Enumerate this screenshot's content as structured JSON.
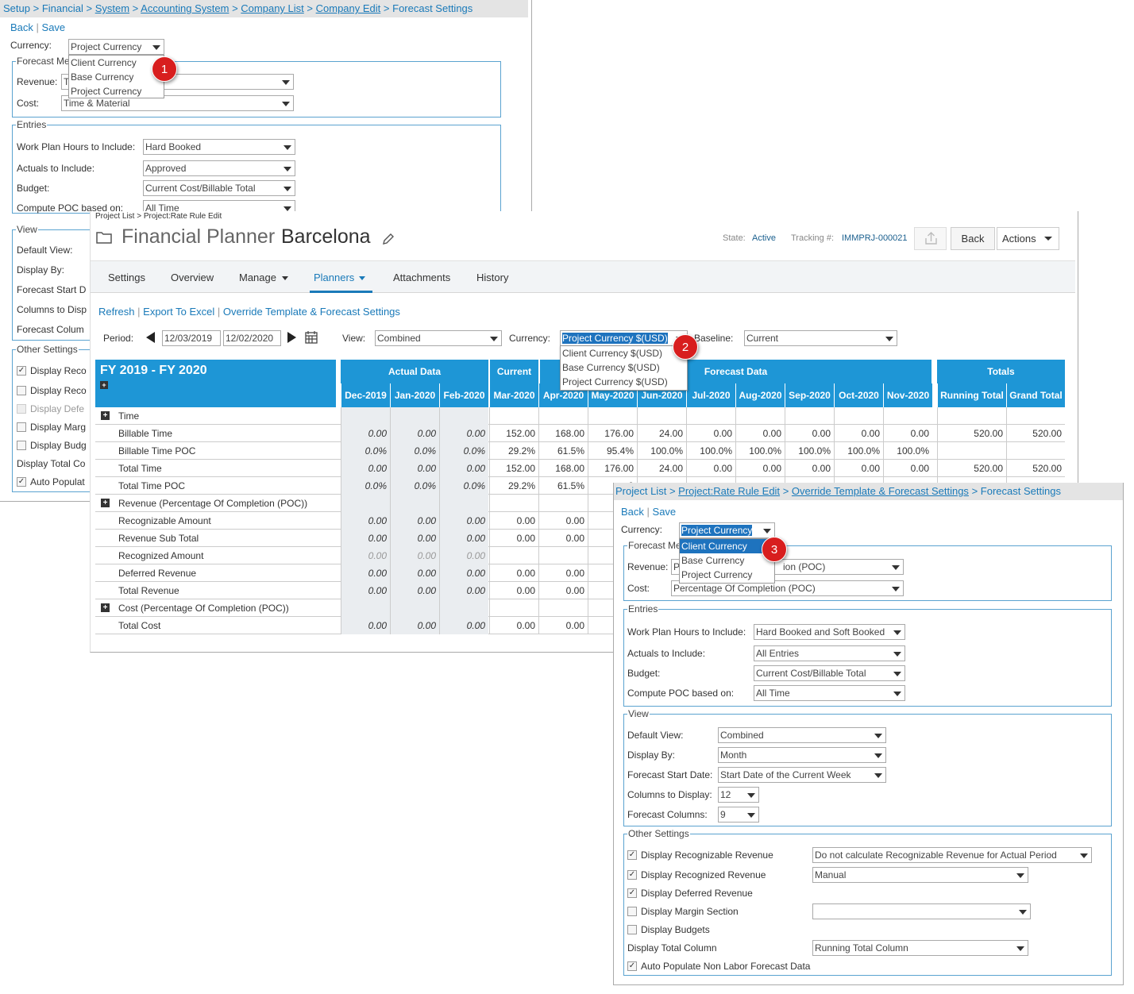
{
  "back_panel": {
    "breadcrumb": [
      "Setup",
      "Financial",
      "System",
      "Accounting System",
      "Company List",
      "Company Edit"
    ],
    "breadcrumb_current": "Forecast Settings",
    "sep": ">",
    "back": "Back",
    "save": "Save",
    "currency_label": "Currency:",
    "currency_value": "Project Currency",
    "currency_options": [
      "Client Currency",
      "Base Currency",
      "Project Currency"
    ],
    "forecast_method_legend": "Forecast Me",
    "revenue_label": "Revenue:",
    "revenue_value": "T",
    "cost_label": "Cost:",
    "cost_value": "Time & Material",
    "entries_legend": "Entries",
    "wph_label": "Work Plan Hours to Include:",
    "wph_value": "Hard Booked",
    "actuals_label": "Actuals to Include:",
    "actuals_value": "Approved",
    "budget_label": "Budget:",
    "budget_value": "Current Cost/Billable Total",
    "poc_label": "Compute POC based on:",
    "poc_value": "All Time",
    "view_legend": "View",
    "default_view_label": "Default View:",
    "display_by_label": "Display By:",
    "forecast_start_label": "Forecast Start D",
    "columns_label": "Columns to Disp",
    "forecast_columns_label": "Forecast Colum",
    "other_legend": "Other Settings",
    "other_items": [
      "Display Reco",
      "Display Reco",
      "Display Defe",
      "Display Marg",
      "Display Budg",
      "Display Total Co",
      "Auto Populat"
    ]
  },
  "planner": {
    "breadcrumb": "Project List > Project:Rate Rule Edit",
    "title": "Financial Planner",
    "project": "Barcelona",
    "state_label": "State:",
    "state_value": "Active",
    "tracking_label": "Tracking #:",
    "tracking_value": "IMMPRJ-000021",
    "back": "Back",
    "actions": "Actions",
    "tabs": [
      "Settings",
      "Overview",
      "Manage",
      "Planners",
      "Attachments",
      "History"
    ],
    "links": [
      "Refresh",
      "Export To Excel",
      "Override Template & Forecast Settings"
    ],
    "period_label": "Period:",
    "period_start": "12/03/2019",
    "period_end": "12/02/2020",
    "view_label": "View:",
    "view_value": "Combined",
    "currency_label": "Currency:",
    "currency_value": "Project Currency $(USD)",
    "currency_options": [
      "Client Currency $(USD)",
      "Base Currency $(USD)",
      "Project Currency $(USD)"
    ],
    "baseline_label": "Baseline:",
    "baseline_value": "Current",
    "fy": "FY 2019 - FY 2020",
    "groups": {
      "actual": "Actual Data",
      "current": "Current",
      "forecast": "Forecast Data",
      "totals": "Totals"
    },
    "months": [
      "Dec-2019",
      "Jan-2020",
      "Feb-2020",
      "Mar-2020",
      "Apr-2020",
      "May-2020",
      "Jun-2020",
      "Jul-2020",
      "Aug-2020",
      "Sep-2020",
      "Oct-2020",
      "Nov-2020"
    ],
    "totals_cols": [
      "Running Total",
      "Grand Total"
    ],
    "rows": [
      {
        "name": "Time",
        "group": true,
        "vals": [
          "",
          "",
          "",
          "",
          "",
          "",
          "",
          "",
          "",
          "",
          "",
          ""
        ],
        "tot": [
          "",
          ""
        ]
      },
      {
        "name": "Billable Time",
        "vals": [
          "0.00",
          "0.00",
          "0.00",
          "152.00",
          "168.00",
          "176.00",
          "24.00",
          "0.00",
          "0.00",
          "0.00",
          "0.00",
          "0.00"
        ],
        "tot": [
          "520.00",
          "520.00"
        ]
      },
      {
        "name": "Billable Time POC",
        "vals": [
          "0.0%",
          "0.0%",
          "0.0%",
          "29.2%",
          "61.5%",
          "95.4%",
          "100.0%",
          "100.0%",
          "100.0%",
          "100.0%",
          "100.0%",
          "100.0%"
        ],
        "tot": [
          "",
          ""
        ]
      },
      {
        "name": "Total Time",
        "vals": [
          "0.00",
          "0.00",
          "0.00",
          "152.00",
          "168.00",
          "176.00",
          "24.00",
          "0.00",
          "0.00",
          "0.00",
          "0.00",
          "0.00"
        ],
        "tot": [
          "520.00",
          "520.00"
        ]
      },
      {
        "name": "Total Time POC",
        "vals": [
          "0.0%",
          "0.0%",
          "0.0%",
          "29.2%",
          "61.5%",
          "9",
          "",
          "",
          "",
          "",
          "",
          ""
        ],
        "tot": [
          "",
          ""
        ]
      },
      {
        "name": "Revenue (Percentage Of Completion (POC))",
        "group": true,
        "vals": [
          "",
          "",
          "",
          "",
          "",
          "",
          "",
          "",
          "",
          "",
          "",
          ""
        ],
        "tot": [
          "",
          ""
        ]
      },
      {
        "name": "Recognizable Amount",
        "vals": [
          "0.00",
          "0.00",
          "0.00",
          "0.00",
          "0.00",
          "",
          "",
          "",
          "",
          "",
          "",
          ""
        ],
        "tot": [
          "",
          ""
        ]
      },
      {
        "name": "Revenue Sub Total",
        "vals": [
          "0.00",
          "0.00",
          "0.00",
          "0.00",
          "0.00",
          "",
          "",
          "",
          "",
          "",
          "",
          ""
        ],
        "tot": [
          "",
          ""
        ]
      },
      {
        "name": "Recognized Amount",
        "dim": true,
        "vals": [
          "0.00",
          "0.00",
          "0.00",
          "",
          "",
          "",
          "",
          "",
          "",
          "",
          "",
          ""
        ],
        "tot": [
          "",
          ""
        ]
      },
      {
        "name": "Deferred Revenue",
        "vals": [
          "0.00",
          "0.00",
          "0.00",
          "0.00",
          "0.00",
          "",
          "",
          "",
          "",
          "",
          "",
          ""
        ],
        "tot": [
          "",
          ""
        ]
      },
      {
        "name": "Total Revenue",
        "vals": [
          "0.00",
          "0.00",
          "0.00",
          "0.00",
          "0.00",
          "",
          "",
          "",
          "",
          "",
          "",
          ""
        ],
        "tot": [
          "",
          ""
        ]
      },
      {
        "name": "Cost (Percentage Of Completion (POC))",
        "group": true,
        "vals": [
          "",
          "",
          "",
          "",
          "",
          "",
          "",
          "",
          "",
          "",
          "",
          ""
        ],
        "tot": [
          "",
          ""
        ]
      },
      {
        "name": "Total Cost",
        "vals": [
          "0.00",
          "0.00",
          "0.00",
          "0.00",
          "0.00",
          "",
          "",
          "",
          "",
          "",
          "",
          ""
        ],
        "tot": [
          "",
          ""
        ]
      }
    ]
  },
  "front_panel": {
    "breadcrumb": [
      "Project List",
      "Project:Rate Rule Edit",
      "Override Template & Forecast Settings"
    ],
    "breadcrumb_current": "Forecast Settings",
    "sep": ">",
    "back": "Back",
    "save": "Save",
    "currency_label": "Currency:",
    "currency_value": "Project Currency",
    "currency_options": [
      "Client Currency",
      "Base Currency",
      "Project Currency"
    ],
    "forecast_method_legend": "Forecast Me",
    "revenue_label": "Revenue:",
    "revenue_value": "P",
    "revenue_value_tail": "ion (POC)",
    "cost_label": "Cost:",
    "cost_value": "Percentage Of Completion (POC)",
    "entries_legend": "Entries",
    "wph_label": "Work Plan Hours to Include:",
    "wph_value": "Hard Booked and Soft Booked",
    "actuals_label": "Actuals to Include:",
    "actuals_value": "All Entries",
    "budget_label": "Budget:",
    "budget_value": "Current Cost/Billable Total",
    "poc_label": "Compute POC based on:",
    "poc_value": "All Time",
    "view_legend": "View",
    "default_view_label": "Default View:",
    "default_view_value": "Combined",
    "display_by_label": "Display By:",
    "display_by_value": "Month",
    "forecast_start_label": "Forecast Start Date:",
    "forecast_start_value": "Start Date of the Current Week",
    "columns_label": "Columns to Display:",
    "columns_value": "12",
    "forecast_columns_label": "Forecast Columns:",
    "forecast_columns_value": "9",
    "other_legend": "Other Settings",
    "recognizable_label": "Display Recognizable Revenue",
    "recognizable_value": "Do not calculate Recognizable Revenue for Actual Period",
    "recognized_label": "Display Recognized Revenue",
    "recognized_value": "Manual",
    "deferred_label": "Display Deferred Revenue",
    "margin_label": "Display Margin Section",
    "margin_value": "",
    "budgets_label": "Display Budgets",
    "total_col_label": "Display Total Column",
    "total_col_value": "Running Total Column",
    "auto_label": "Auto Populate Non Labor Forecast Data"
  },
  "markers": [
    "1",
    "2",
    "3"
  ],
  "icons": {
    "folder": "folder-icon",
    "edit": "pencil-icon",
    "share": "share-icon",
    "calendar": "calendar-icon"
  },
  "colors": {
    "header_blue": "#1e96d6",
    "link_blue": "#1a7ab9",
    "marker_red": "#d81e1e",
    "highlight": "#1e73be"
  }
}
